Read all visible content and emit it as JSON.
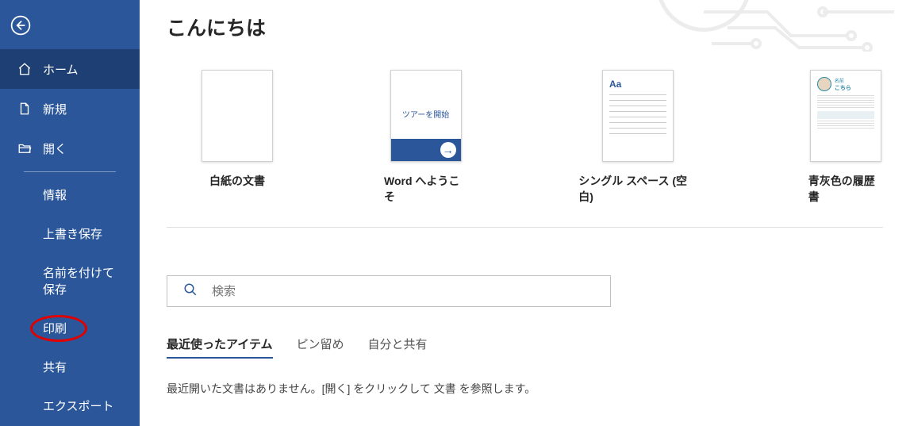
{
  "greeting": "こんにちは",
  "sidebar": {
    "primary": [
      {
        "label": "ホーム",
        "icon": "home"
      },
      {
        "label": "新規",
        "icon": "file"
      },
      {
        "label": "開く",
        "icon": "folder"
      }
    ],
    "secondary": [
      {
        "label": "情報"
      },
      {
        "label": "上書き保存"
      },
      {
        "label": "名前を付けて保存"
      },
      {
        "label": "印刷",
        "highlighted": true
      },
      {
        "label": "共有"
      },
      {
        "label": "エクスポート"
      }
    ]
  },
  "templates": [
    {
      "label": "白紙の文書",
      "kind": "blank"
    },
    {
      "label": "Word へようこそ",
      "kind": "tour",
      "tour_text": "ツアーを開始"
    },
    {
      "label": "シングル スペース (空白)",
      "kind": "single",
      "aa": "Aa"
    },
    {
      "label": "青灰色の履歴書",
      "kind": "resume",
      "name_text": "名前",
      "sub_text": "こちら"
    }
  ],
  "search": {
    "placeholder": "検索"
  },
  "tabs": [
    {
      "label": "最近使ったアイテム",
      "active": true
    },
    {
      "label": "ピン留め"
    },
    {
      "label": "自分と共有"
    }
  ],
  "empty_message": "最近開いた文書はありません。[開く] をクリックして 文書 を参照します。"
}
